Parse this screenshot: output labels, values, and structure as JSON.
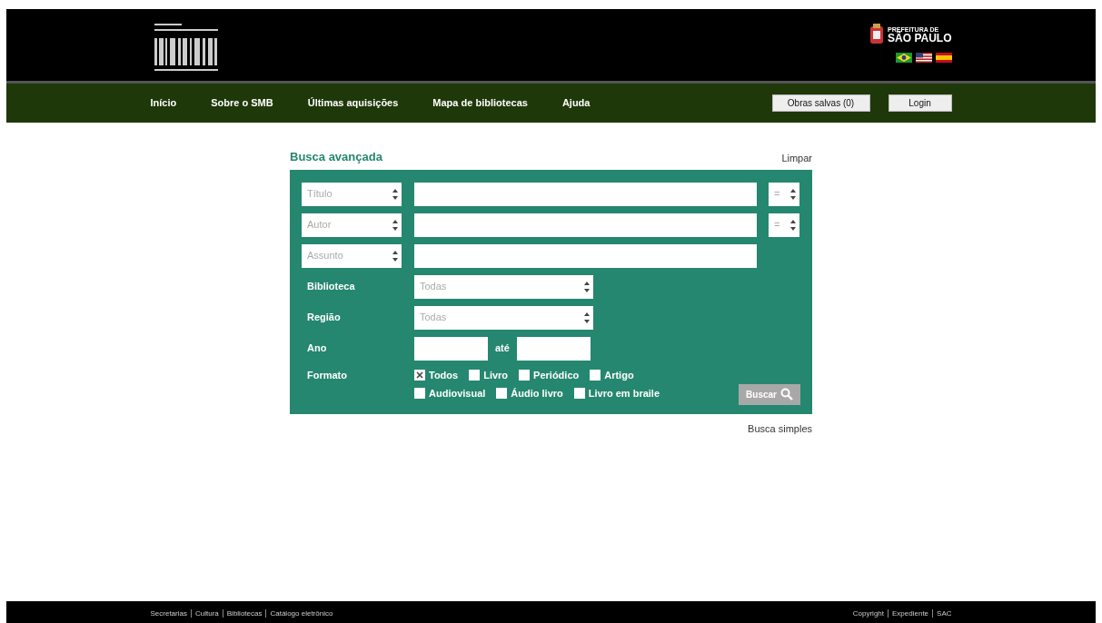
{
  "header": {
    "city_logo": {
      "line1": "PREFEITURA DE",
      "line2": "SÃO PAULO"
    }
  },
  "nav": {
    "items": [
      {
        "label": "Início"
      },
      {
        "label": "Sobre o SMB"
      },
      {
        "label": "Últimas aquisições"
      },
      {
        "label": "Mapa de bibliotecas"
      },
      {
        "label": "Ajuda"
      }
    ],
    "buttons": [
      "Obras salvas (0)",
      "Login"
    ]
  },
  "search": {
    "title": "Busca avançada",
    "clear_link": "Limpar",
    "term_rows": [
      {
        "field": "Título",
        "operator": "="
      },
      {
        "field": "Autor",
        "operator": "="
      },
      {
        "field": "Assunto"
      }
    ],
    "selects": [
      {
        "label": "Biblioteca",
        "value": "Todas"
      },
      {
        "label": "Região",
        "value": "Todas"
      }
    ],
    "year": {
      "label": "Ano",
      "separator": "até"
    },
    "format": {
      "label": "Formato",
      "option_rows": [
        [
          {
            "label": "Todos",
            "checked": true
          },
          {
            "label": "Livro",
            "checked": false
          },
          {
            "label": "Periódico",
            "checked": false
          },
          {
            "label": "Artigo",
            "checked": false
          }
        ],
        [
          {
            "label": "Audiovisual",
            "checked": false
          },
          {
            "label": "Áudio livro",
            "checked": false
          },
          {
            "label": "Livro em braile",
            "checked": false
          }
        ]
      ]
    },
    "submit": "Buscar",
    "simple_link": "Busca simples"
  },
  "footer": {
    "left": [
      "Secretarias",
      "Cultura",
      "Bibliotecas",
      "Catálogo eletrônico"
    ],
    "right": [
      "Copyright",
      "Expediente",
      "SAC"
    ]
  }
}
